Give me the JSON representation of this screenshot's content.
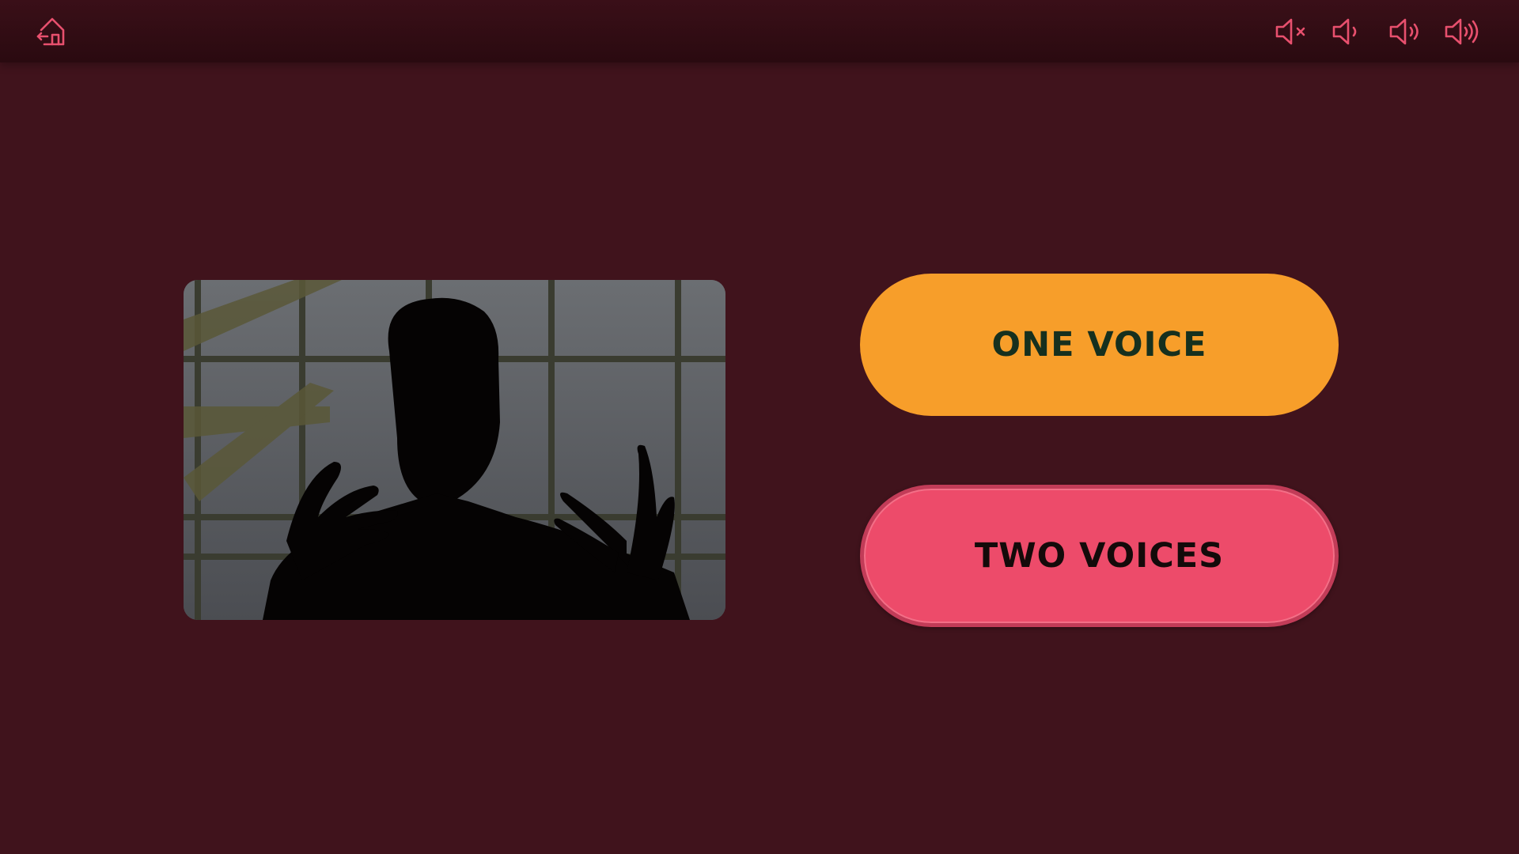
{
  "header": {
    "home_icon": "home-exit-icon",
    "volume_controls": [
      {
        "icon": "volume-mute-icon",
        "level": 0
      },
      {
        "icon": "volume-low-icon",
        "level": 1
      },
      {
        "icon": "volume-medium-icon",
        "level": 2
      },
      {
        "icon": "volume-high-icon",
        "level": 3
      }
    ]
  },
  "main": {
    "video_thumbnail": "silhouette-person-speaking",
    "choices": [
      {
        "label": "ONE VOICE",
        "color": "#f79e2a"
      },
      {
        "label": "TWO VOICES",
        "color": "#ed4b6a"
      }
    ]
  },
  "colors": {
    "background": "#40131c",
    "topbar": "#2a0a10",
    "icon_accent": "#e8506e"
  }
}
